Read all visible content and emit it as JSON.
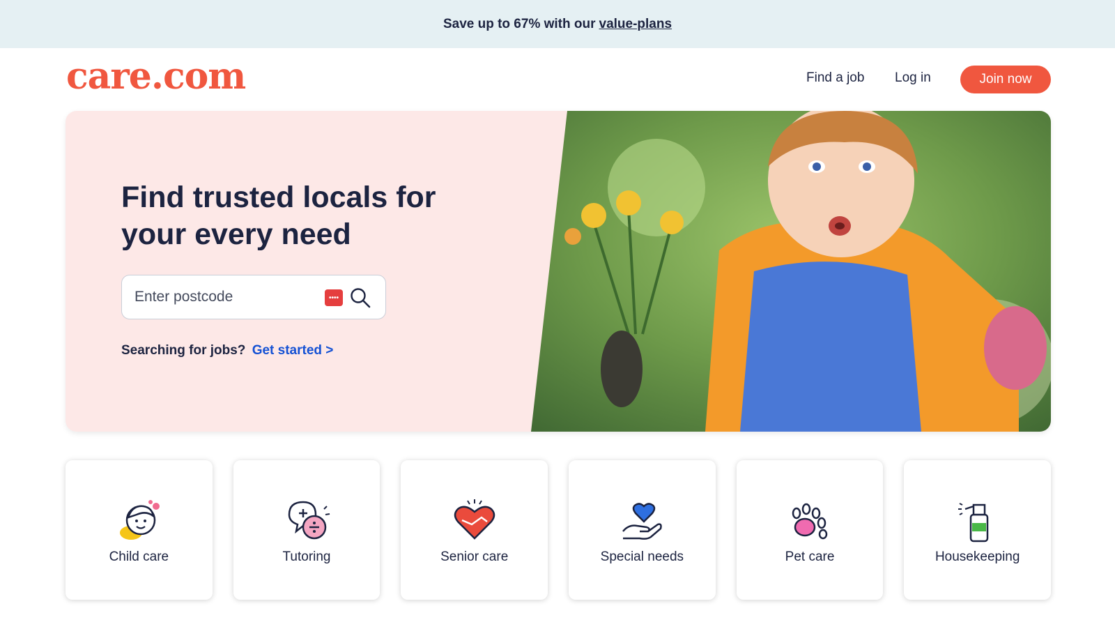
{
  "promo": {
    "text": "Save up to 67% with our",
    "link": "value-plans"
  },
  "header": {
    "logo": "care.com",
    "nav": {
      "find_job": "Find a job",
      "login": "Log in",
      "join": "Join now"
    }
  },
  "hero": {
    "title": "Find trusted locals for your every need",
    "search": {
      "placeholder": "Enter postcode",
      "value": ""
    },
    "password_icon_text": "••••",
    "jobs_prompt": "Searching for jobs?",
    "jobs_link": "Get started >"
  },
  "categories": [
    {
      "label": "Child care",
      "icon": "child-care-icon"
    },
    {
      "label": "Tutoring",
      "icon": "tutoring-icon"
    },
    {
      "label": "Senior care",
      "icon": "senior-care-icon"
    },
    {
      "label": "Special needs",
      "icon": "special-needs-icon"
    },
    {
      "label": "Pet care",
      "icon": "pet-care-icon"
    },
    {
      "label": "Housekeeping",
      "icon": "housekeeping-icon"
    }
  ],
  "colors": {
    "brand": "#f0573f",
    "link": "#1451d4",
    "text": "#1c2340",
    "hero_bg": "#fde8e7",
    "promo_bg": "#e5f0f3"
  }
}
